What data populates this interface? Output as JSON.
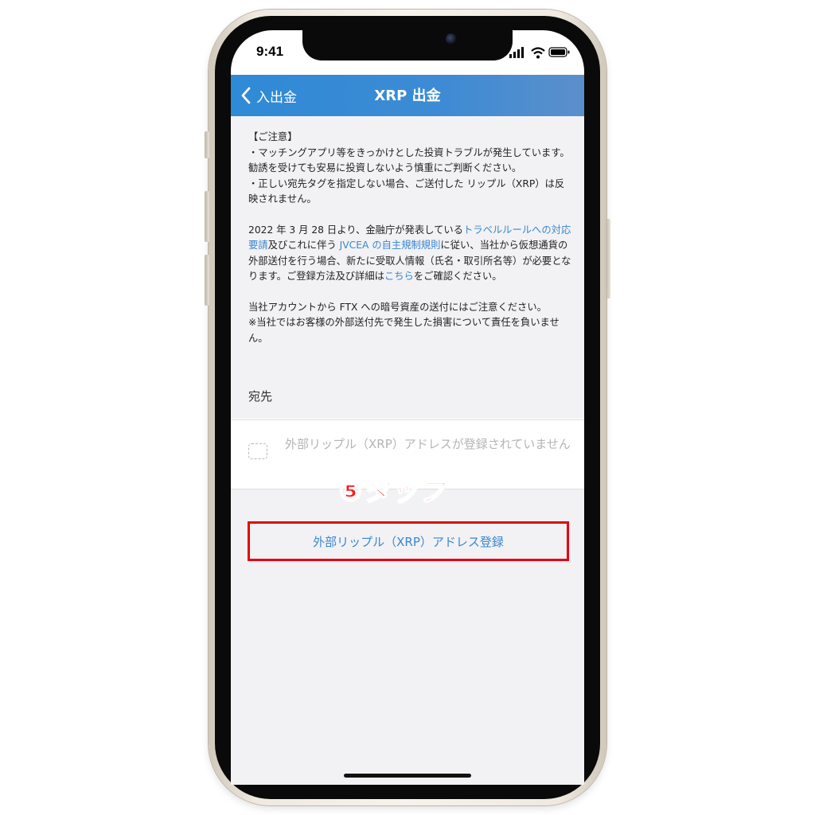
{
  "status_bar": {
    "time": "9:41"
  },
  "navbar": {
    "back_label": "入出金",
    "title": "XRP 出金"
  },
  "notice": {
    "heading": "【ご注意】",
    "bullet_1": "・マッチングアプリ等をきっかけとした投資トラブルが発生しています。勧誘を受けても安易に投資しないよう慎重にご判断ください。",
    "bullet_2": "・正しい宛先タグを指定しない場合、ご送付した リップル（XRP）は反映されません。",
    "travel_rule_pre": "2022 年 3 月 28 日より、金融庁が発表している",
    "travel_rule_link": "トラベルルールへの対応要請",
    "travel_rule_mid": "及びこれに伴う ",
    "jvcea_link": "JVCEA の自主規制規則",
    "travel_rule_post": "に従い、当社から仮想通貨の外部送付を行う場合、新たに受取人情報（氏名・取引所名等）が必要となります。ご登録方法及び詳細は",
    "kochira_link": "こちら",
    "travel_rule_end": "をご確認ください。",
    "ftx_line": "当社アカウントから FTX への暗号資産の送付にはご注意ください。",
    "ftx_note": "※当社ではお客様の外部送付先で発生した損害について責任を負いません。"
  },
  "destination": {
    "section_label": "宛先",
    "empty_message": "外部リップル（XRP）アドレスが登録されていません"
  },
  "annotation": {
    "step_label": "⑤タップ"
  },
  "register_button": {
    "label": "外部リップル（XRP）アドレス登録"
  },
  "colors": {
    "nav_blue": "#3d8bd4",
    "link_blue": "#3a86cf",
    "highlight_red": "#e60012",
    "background_gray": "#f2f2f4"
  }
}
